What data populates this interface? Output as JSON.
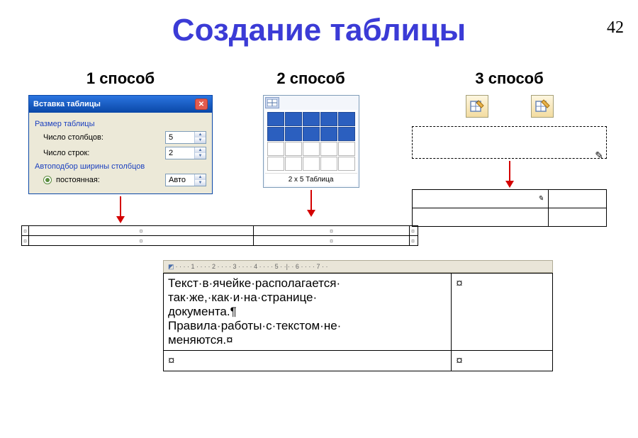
{
  "page_number": "42",
  "title": "Создание таблицы",
  "methods": {
    "m1": {
      "label": "1 способ"
    },
    "m2": {
      "label": "2 способ"
    },
    "m3": {
      "label": "3 способ"
    }
  },
  "dialog": {
    "title": "Вставка таблицы",
    "section_size": "Размер таблицы",
    "columns_label": "Число столбцов:",
    "columns_value": "5",
    "rows_label": "Число строк:",
    "rows_value": "2",
    "section_autofit": "Автоподбор ширины столбцов",
    "fixed_label": "постоянная:",
    "fixed_value": "Авто"
  },
  "grid": {
    "caption": "2 x 5 Таблица",
    "rows": 4,
    "cols": 5,
    "selected_rows": 2,
    "selected_cols": 5
  },
  "ruler_marks": [
    "1",
    "2",
    "3",
    "4",
    "5",
    "6",
    "7"
  ],
  "doc_text": {
    "line1": "Текст·в·ячейке·располагается·",
    "line2": "так·же,·как·и·на·странице·",
    "line3": "документа.¶",
    "line4": "Правила·работы·с·текстом·не·",
    "line5": "меняются.¤",
    "empty_mark": "¤"
  },
  "ruler_cell_mark": "¤"
}
